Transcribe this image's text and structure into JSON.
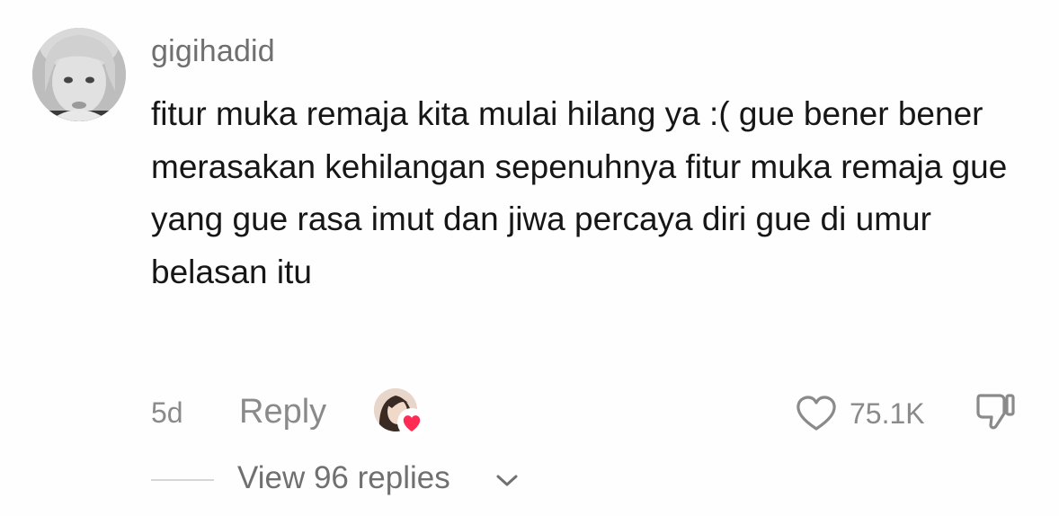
{
  "comment": {
    "username": "gigihadid",
    "text": "fitur muka remaja kita mulai hilang ya :( gue bener bener merasakan kehilangan sepenuhnya fitur muka remaja gue yang gue rasa imut dan jiwa percaya diri gue di umur belasan itu",
    "time": "5d",
    "reply_label": "Reply",
    "like_count": "75.1K",
    "view_replies_label": "View 96 replies"
  },
  "icons": {
    "avatar": "user-avatar",
    "creator_like": "creator-liked-avatar-icon",
    "heart": "heart-icon",
    "like": "heart-outline-icon",
    "dislike": "thumbs-down-icon",
    "chevron": "chevron-down-icon"
  },
  "colors": {
    "username": "#6f6f6f",
    "text": "#161616",
    "meta": "#8a8a8a",
    "heart": "#fe2c55"
  }
}
